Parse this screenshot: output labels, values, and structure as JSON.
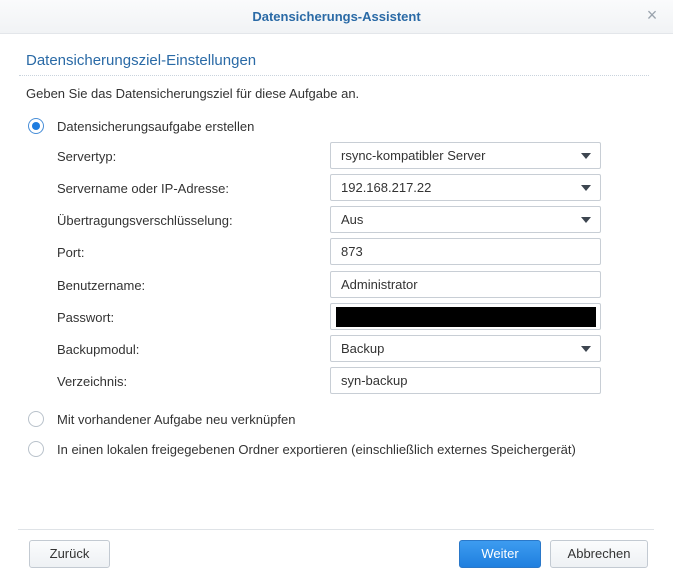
{
  "window": {
    "title": "Datensicherungs-Assistent",
    "close_glyph": "×"
  },
  "section": {
    "title": "Datensicherungsziel-Einstellungen",
    "description": "Geben Sie das Datensicherungsziel für diese Aufgabe an."
  },
  "options": {
    "create_task": {
      "label": "Datensicherungsaufgabe erstellen",
      "selected": true
    },
    "relink_task": {
      "label": "Mit vorhandener Aufgabe neu verknüpfen",
      "selected": false
    },
    "export_local": {
      "label": "In einen lokalen freigegebenen Ordner exportieren (einschließlich externes Speichergerät)",
      "selected": false
    }
  },
  "form": {
    "server_type": {
      "label": "Servertyp:",
      "value": "rsync-kompatibler Server"
    },
    "server_name": {
      "label": "Servername oder IP-Adresse:",
      "value": "192.168.217.22"
    },
    "encryption": {
      "label": "Übertragungsverschlüsselung:",
      "value": "Aus"
    },
    "port": {
      "label": "Port:",
      "value": "873"
    },
    "username": {
      "label": "Benutzername:",
      "value": "Administrator"
    },
    "password": {
      "label": "Passwort:",
      "value": ""
    },
    "backup_module": {
      "label": "Backupmodul:",
      "value": "Backup"
    },
    "directory": {
      "label": "Verzeichnis:",
      "value": "syn-backup"
    }
  },
  "buttons": {
    "back": "Zurück",
    "next": "Weiter",
    "cancel": "Abbrechen"
  },
  "colors": {
    "accent": "#2a6aa6",
    "primary_button": "#1f7fdf"
  },
  "icons": {
    "close": "close-icon",
    "dropdown": "chevron-down-icon"
  }
}
